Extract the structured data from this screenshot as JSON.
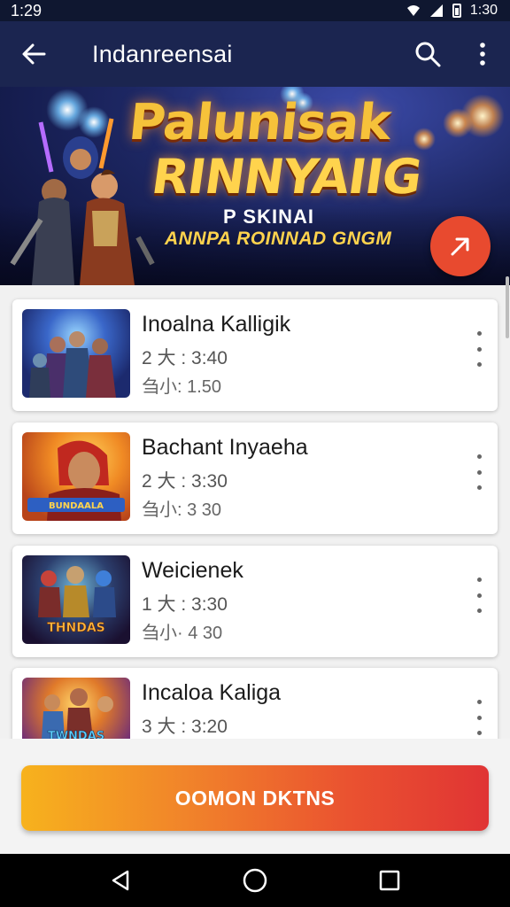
{
  "status_bar": {
    "time": "1:29",
    "right_text": "1:30"
  },
  "app_bar": {
    "title": "Indanreensai"
  },
  "banner": {
    "title_line1": "Palunisak",
    "title_line2": "RINNYAIIG",
    "subtitle": "P SKINAI",
    "tagline": "ANNPA ROINNAD GNGM"
  },
  "items": [
    {
      "name": "Inoalna Kalligik",
      "meta1": "2 大 : 3:40",
      "meta2": "刍小: 1.50",
      "thumb_caption": ""
    },
    {
      "name": "Bachant Inyaeha",
      "meta1": "2 大 : 3:30",
      "meta2": "刍小: 3 30",
      "thumb_caption": "BUNDAALA"
    },
    {
      "name": "Weicienek",
      "meta1": "1 大 : 3:30",
      "meta2": "刍小· 4 30",
      "thumb_caption": "THNDAS"
    },
    {
      "name": "Incaloa Kaliga",
      "meta1": "3 大 : 3:20",
      "meta2": "",
      "thumb_caption": "TWNDAS"
    }
  ],
  "cta": {
    "label": "OOMON DKTNS"
  },
  "colors": {
    "app_bar": "#1b2550",
    "fab": "#e84a2f",
    "cta_start": "#f7b21d",
    "cta_end": "#e03434"
  }
}
